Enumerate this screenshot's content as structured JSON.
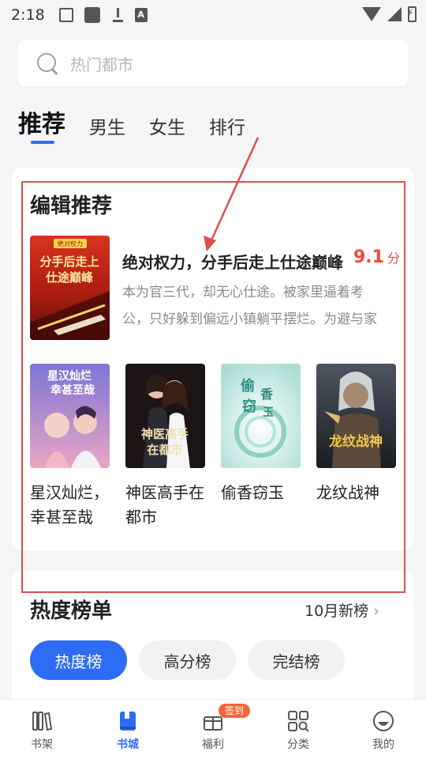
{
  "status_bar": {
    "time": "2:18",
    "notif_icons": [
      "image-icon",
      "app-icon",
      "download-icon",
      "font-icon"
    ]
  },
  "search": {
    "placeholder": "热门都市"
  },
  "tabs": [
    {
      "label": "推荐",
      "active": true
    },
    {
      "label": "男生",
      "active": false
    },
    {
      "label": "女生",
      "active": false
    },
    {
      "label": "排行",
      "active": false
    }
  ],
  "editor_picks": {
    "title": "编辑推荐",
    "featured": {
      "title": "绝对权力，分手后走上仕途巅峰",
      "rating": "9.1",
      "rating_unit": "分",
      "description": "本为官三代，却无心仕途。被家里逼着考公，只好躲到偏远小镇躺平摆烂。为避与家族联姻……",
      "cover_text": "分手后走上仕途巅峰",
      "cover_badge": "绝对权力"
    },
    "books": [
      {
        "name": "星汉灿烂，幸甚至哉",
        "cover_text": "星汉灿烂幸甚至哉"
      },
      {
        "name": "神医高手在都市",
        "cover_text": "神医高手在都市"
      },
      {
        "name": "偷香窃玉",
        "cover_text": "偷香窃玉"
      },
      {
        "name": "龙纹战神",
        "cover_text": "龙纹战神"
      }
    ]
  },
  "hot_list": {
    "title": "热度榜单",
    "more_link": "10月新榜",
    "pills": [
      {
        "label": "热度榜",
        "active": true
      },
      {
        "label": "高分榜",
        "active": false
      },
      {
        "label": "完结榜",
        "active": false
      }
    ]
  },
  "bottom_nav": [
    {
      "label": "书架",
      "icon": "bookshelf-icon",
      "active": false
    },
    {
      "label": "书城",
      "icon": "book-icon",
      "active": true
    },
    {
      "label": "福利",
      "icon": "gift-icon",
      "active": false,
      "badge": "签到"
    },
    {
      "label": "分类",
      "icon": "category-icon",
      "active": false
    },
    {
      "label": "我的",
      "icon": "profile-icon",
      "active": false
    }
  ],
  "colors": {
    "accent": "#2f6cf6",
    "rating": "#ef4b3c",
    "highlight": "#e14c4c",
    "badge": "#f6643c"
  }
}
